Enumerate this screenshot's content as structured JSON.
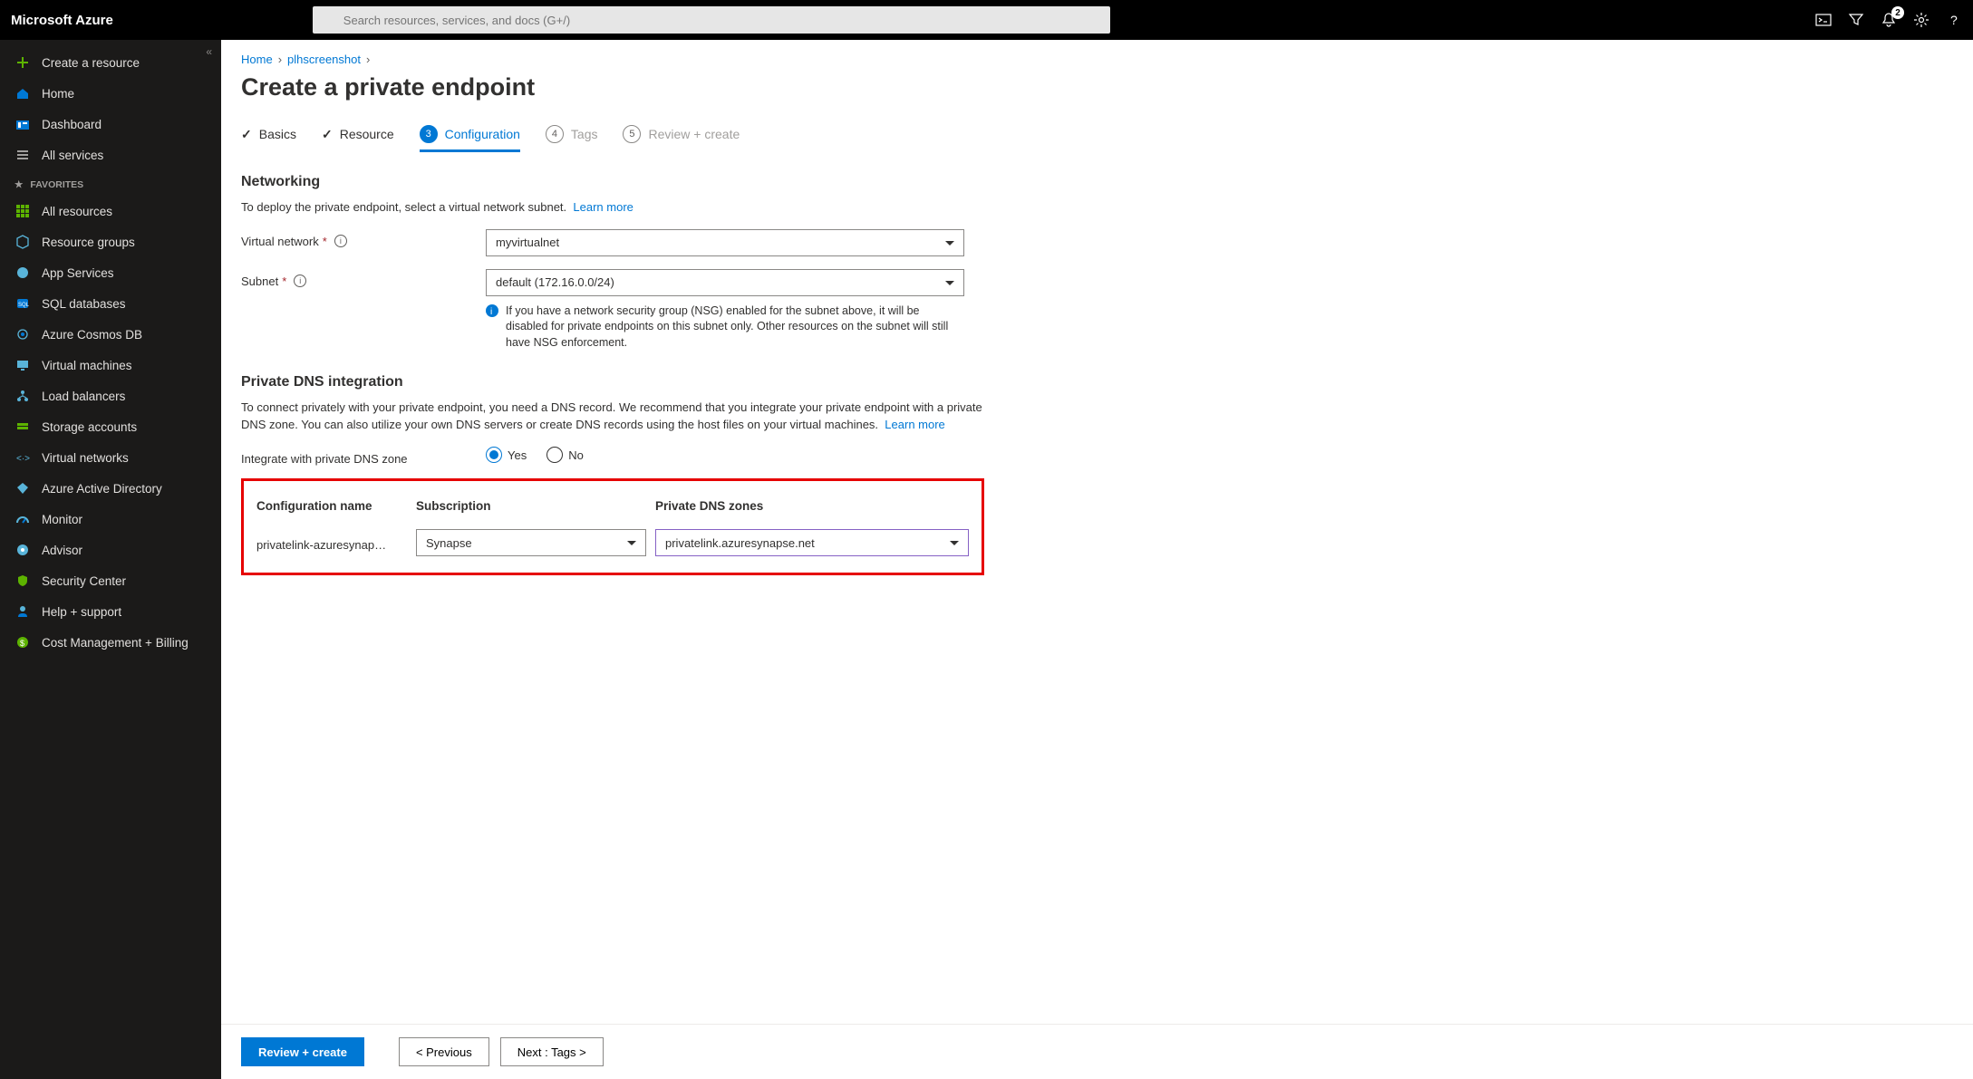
{
  "brand": "Microsoft Azure",
  "search": {
    "placeholder": "Search resources, services, and docs (G+/)"
  },
  "notifications": {
    "count": "2"
  },
  "sidebar": {
    "create": "Create a resource",
    "home": "Home",
    "dashboard": "Dashboard",
    "all_services": "All services",
    "fav_label": "FAVORITES",
    "items": [
      "All resources",
      "Resource groups",
      "App Services",
      "SQL databases",
      "Azure Cosmos DB",
      "Virtual machines",
      "Load balancers",
      "Storage accounts",
      "Virtual networks",
      "Azure Active Directory",
      "Monitor",
      "Advisor",
      "Security Center",
      "Help + support",
      "Cost Management + Billing"
    ]
  },
  "breadcrumb": {
    "home": "Home",
    "item": "plhscreenshot"
  },
  "page_title": "Create a private endpoint",
  "tabs": {
    "basics": "Basics",
    "resource": "Resource",
    "config": "Configuration",
    "tags": "Tags",
    "review": "Review + create"
  },
  "section_net": {
    "title": "Networking",
    "desc": "To deploy the private endpoint, select a virtual network subnet.",
    "learn": "Learn more",
    "vnet_label": "Virtual network",
    "vnet_value": "myvirtualnet",
    "subnet_label": "Subnet",
    "subnet_value": "default (172.16.0.0/24)",
    "subnet_hint": "If you have a network security group (NSG) enabled for the subnet above, it will be disabled for private endpoints on this subnet only. Other resources on the subnet will still have NSG enforcement."
  },
  "section_dns": {
    "title": "Private DNS integration",
    "desc": "To connect privately with your private endpoint, you need a DNS record. We recommend that you integrate your private endpoint with a private DNS zone. You can also utilize your own DNS servers or create DNS records using the host files on your virtual machines.",
    "learn": "Learn more",
    "integrate_label": "Integrate with private DNS zone",
    "yes": "Yes",
    "no": "No",
    "cols": {
      "name": "Configuration name",
      "sub": "Subscription",
      "zone": "Private DNS zones"
    },
    "row": {
      "name": "privatelink-azuresynap…",
      "sub": "Synapse",
      "zone": "privatelink.azuresynapse.net"
    }
  },
  "footer": {
    "review": "Review + create",
    "prev": "< Previous",
    "next": "Next : Tags >"
  }
}
